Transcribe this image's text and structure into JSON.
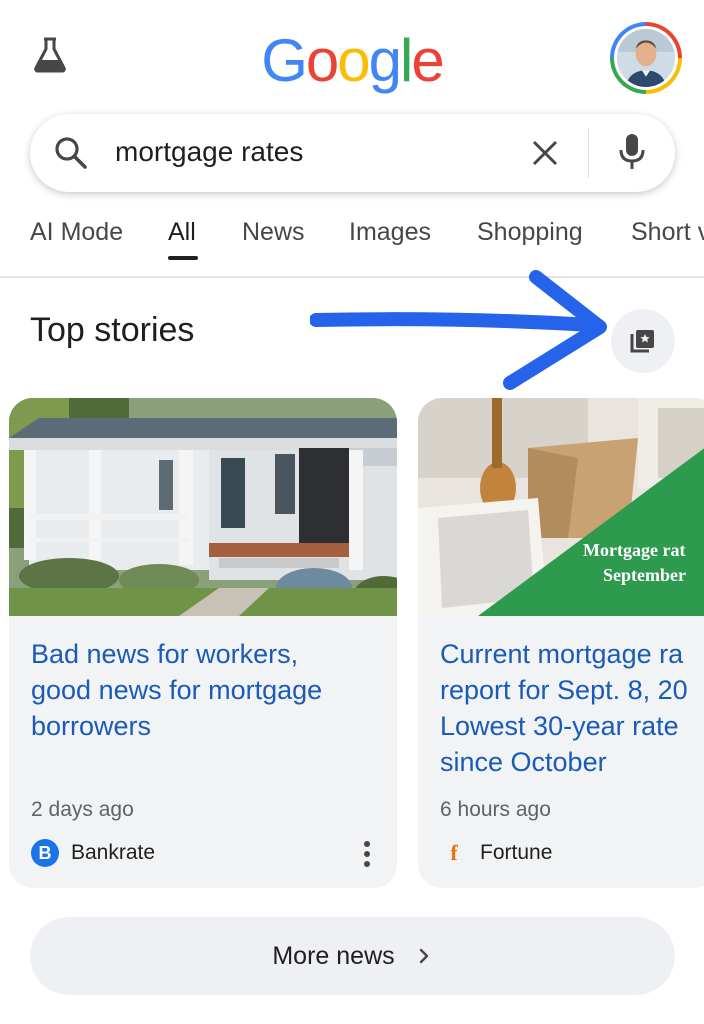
{
  "header": {
    "logo_letters": [
      {
        "char": "G",
        "color": "#4285f4"
      },
      {
        "char": "o",
        "color": "#ea4335"
      },
      {
        "char": "o",
        "color": "#fbbc04"
      },
      {
        "char": "g",
        "color": "#4285f4"
      },
      {
        "char": "l",
        "color": "#34a853"
      },
      {
        "char": "e",
        "color": "#ea4335"
      }
    ],
    "labs_icon": "flask-icon",
    "avatar": "user-avatar"
  },
  "search": {
    "query": "mortgage rates",
    "search_icon": "search-icon",
    "clear_icon": "close-icon",
    "mic_icon": "mic-icon"
  },
  "tabs": [
    {
      "label": "AI Mode",
      "active": false
    },
    {
      "label": "All",
      "active": true
    },
    {
      "label": "News",
      "active": false
    },
    {
      "label": "Images",
      "active": false
    },
    {
      "label": "Shopping",
      "active": false
    },
    {
      "label": "Short v",
      "active": false
    }
  ],
  "top_stories": {
    "title": "Top stories",
    "save_icon": "bookmark-collection-icon",
    "annotation": "blue-arrow-pointing-to-save-button",
    "cards": [
      {
        "headline": "Bad news for workers,\ngood news for mortgage\nborrowers",
        "time": "2 days ago",
        "source": "Bankrate",
        "source_logo": "B",
        "image_overlay_text": ""
      },
      {
        "headline": "Current mortgage ra\nreport for Sept. 8, 20\nLowest 30-year rate\nsince October",
        "time": "6 hours ago",
        "source": "Fortune",
        "source_logo": "f",
        "image_overlay_text_line1": "Mortgage rat",
        "image_overlay_text_line2": "September"
      }
    ],
    "more_label": "More news"
  },
  "colors": {
    "accent_blue": "#1a5bb8",
    "annotation_blue": "#2563eb",
    "card_bg": "#f1f3f4"
  }
}
